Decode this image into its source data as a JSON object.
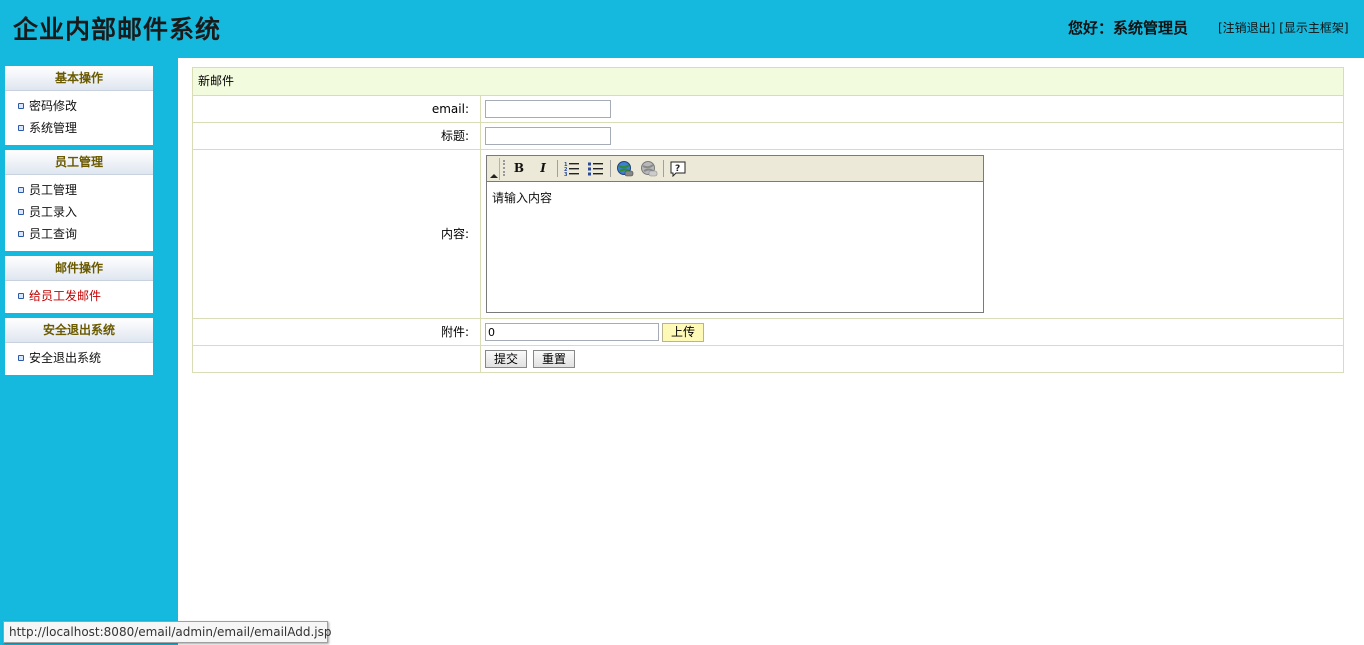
{
  "header": {
    "title": "企业内部邮件系统",
    "greeting_prefix": "您好：",
    "user_name": "系统管理员",
    "logout_link": "[注销退出]",
    "frame_link": "[显示主框架]"
  },
  "sidebar": {
    "groups": [
      {
        "title": "基本操作",
        "items": [
          {
            "label": "密码修改"
          },
          {
            "label": "系统管理"
          }
        ]
      },
      {
        "title": "员工管理",
        "items": [
          {
            "label": "员工管理"
          },
          {
            "label": "员工录入"
          },
          {
            "label": "员工查询"
          }
        ]
      },
      {
        "title": "邮件操作",
        "items": [
          {
            "label": "给员工发邮件",
            "active": true
          }
        ]
      },
      {
        "title": "安全退出系统",
        "items": [
          {
            "label": "安全退出系统"
          }
        ]
      }
    ]
  },
  "form": {
    "title": "新邮件",
    "email_label": "email:",
    "email_value": "",
    "subject_label": "标题:",
    "subject_value": "",
    "content_label": "内容:",
    "content_value": "请输入内容",
    "attach_label": "附件:",
    "attach_value": "0",
    "upload_button": "上传",
    "submit_button": "提交",
    "reset_button": "重置",
    "toolbar": {
      "bold": "B",
      "italic": "I",
      "icons": [
        "bold-icon",
        "italic-icon",
        "ordered-list-icon",
        "unordered-list-icon",
        "insert-link-icon",
        "remove-link-icon",
        "help-icon"
      ]
    }
  },
  "statusbar": {
    "url": "http://localhost:8080/email/admin/email/emailAdd.jsp"
  },
  "colors": {
    "header_bg": "#15b9de",
    "sidebar_bg": "#15b9de",
    "form_title_bg": "#f3fbdf",
    "active_menu": "#c00000",
    "menu_head_text": "#6b5a00"
  }
}
